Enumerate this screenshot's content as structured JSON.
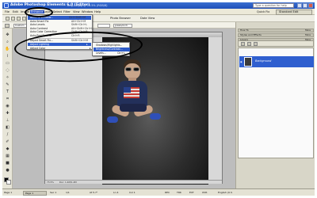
{
  "window": {
    "title": "Adobe Photoshop Elements 6.0 (Editor)",
    "doc_info": "Img-04.jpg @ 73.5% (RGB/8)",
    "help_placeholder": "Type a question for help"
  },
  "menu": {
    "items": [
      "File",
      "Edit",
      "Image",
      "Enhance",
      "Layer",
      "Select",
      "Filter",
      "View",
      "Window",
      "Help"
    ],
    "active": "Enhance",
    "quick_fix": "Quick Fix",
    "standard_edit": "Standard Edit"
  },
  "shortcuts": {
    "photo_browser": "Photo Browser",
    "date_view": "Date View"
  },
  "options_bar": {
    "size_value": "Custom",
    "units": "pixels/inch",
    "resolution_label": "Resolution"
  },
  "enhance_menu": {
    "items": [
      {
        "label": "Auto Fix Window...",
        "shortcut": "Ctrl+Shift+M",
        "selected": true
      },
      {
        "label": "Auto Smart Fix",
        "shortcut": "Alt+Ctrl+M"
      },
      {
        "label": "Auto Levels",
        "shortcut": "Shift+Ctrl+L"
      },
      {
        "label": "Auto Contrast",
        "shortcut": "Alt+Shift+Ctrl+L"
      },
      {
        "label": "Auto Color Correction",
        "shortcut": "Shift+Ctrl+B"
      },
      {
        "label": "Auto Red Eye Fix",
        "shortcut": "Ctrl+R"
      },
      {
        "label": "Adjust Smart Fix...",
        "shortcut": "Shift+Ctrl+M"
      },
      {
        "label": "Adjust Lighting",
        "shortcut": "",
        "highlighted": true
      },
      {
        "label": "Adjust Color",
        "shortcut": ""
      }
    ]
  },
  "lighting_submenu": {
    "items": [
      {
        "label": "Shadows/Highlights...",
        "shortcut": ""
      },
      {
        "label": "Brightness/Contrast...",
        "shortcut": "",
        "selected": true
      },
      {
        "label": "Levels...",
        "shortcut": "Ctrl+L"
      }
    ]
  },
  "palettes": {
    "how_to": "How To",
    "styles": "Styles and Effects",
    "layers": "Layers",
    "more": "More",
    "layer_name": "Background"
  },
  "document": {
    "tab": "Img-04.jpg @ 73.5% (RGB/8)",
    "status_zoom": "73.5%",
    "status_size": "Doc: 1.4M/1.4M"
  },
  "taskbar": {
    "page": "Page 1",
    "sections": [
      "Page 1",
      "Sec 1",
      "1/1",
      "At 5.7\"",
      "Ln 4",
      "Col 1",
      "REC",
      "TRK",
      "EXT",
      "OVR",
      "English (U.S"
    ]
  },
  "colors": {
    "accent": "#2c5bc8",
    "annotation": "#000000"
  }
}
